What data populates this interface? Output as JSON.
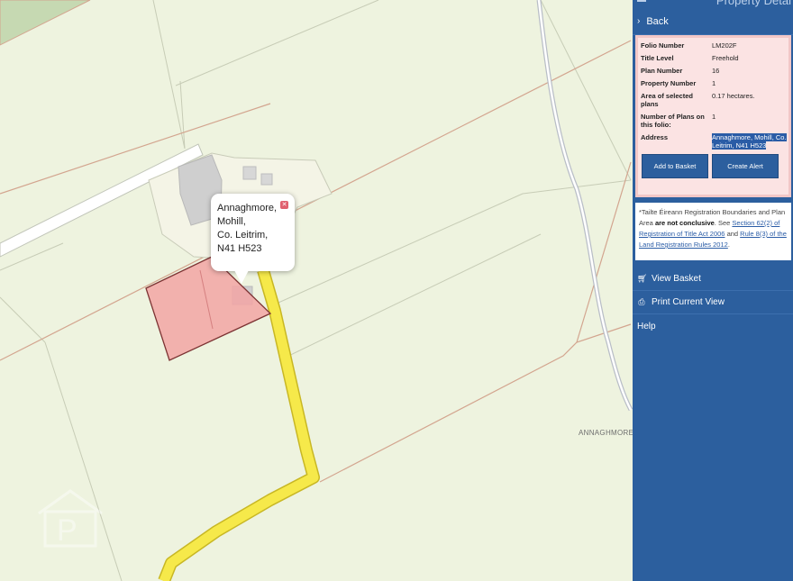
{
  "map": {
    "popup": {
      "line1": "Annaghmore,",
      "line2": "Mohill,",
      "line3": "Co. Leitrim,",
      "line4": "N41 H523"
    },
    "place_label": "ANNAGHMORE",
    "watermark_text": "P"
  },
  "sidebar": {
    "title": "Property Detai",
    "back_label": "Back",
    "details": [
      {
        "key": "Folio Number",
        "value": "LM202F"
      },
      {
        "key": "Title Level",
        "value": "Freehold"
      },
      {
        "key": "Plan Number",
        "value": "16"
      },
      {
        "key": "Property Number",
        "value": "1"
      },
      {
        "key": "Area of selected plans",
        "value": "0.17 hectares."
      },
      {
        "key": "Number of Plans on this folio:",
        "value": "1"
      },
      {
        "key": "Address",
        "value": "Annaghmore, Mohill, Co. Leitrim, N41 H523"
      }
    ],
    "add_to_basket": "Add to Basket",
    "create_alert": "Create Alert",
    "notice": {
      "p1": "*Tailte Éireann Registration Boundaries and Plan Area ",
      "bold": "are not conclusive",
      "p2": ". See ",
      "link1": "Section 62(2) of Registration of Title Act 2006",
      "p3": " and ",
      "link2": "Rule 8(3) of the Land Registration Rules 2012",
      "p4": "."
    },
    "menu": [
      {
        "label": "View Basket",
        "icon": "cart-icon"
      },
      {
        "label": "Print Current View",
        "icon": "print-icon"
      },
      {
        "label": "Help",
        "icon": ""
      }
    ]
  },
  "colors": {
    "map_bg": "#eef3df",
    "sidebar_bg": "#2c5f9e",
    "parcel_fill": "#f2a4a4",
    "road_yellow": "#f6e94a",
    "boundary_line": "#d3a58f",
    "details_bg": "#fbe3e3"
  }
}
